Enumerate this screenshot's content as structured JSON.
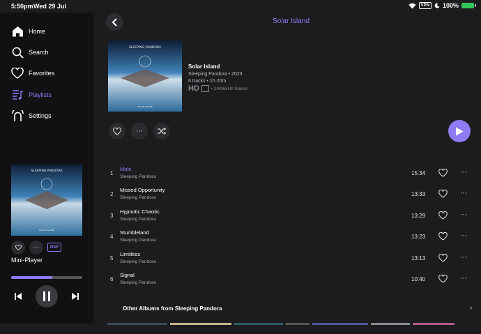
{
  "status": {
    "time": "5:50pm",
    "date": "Wed 29 Jul",
    "vpn": "VPN",
    "battery": "100%"
  },
  "sidebar": {
    "items": [
      {
        "label": "Home",
        "icon": "home-icon"
      },
      {
        "label": "Search",
        "icon": "search-icon"
      },
      {
        "label": "Favorites",
        "icon": "heart-icon"
      },
      {
        "label": "Playlists",
        "icon": "playlist-icon",
        "active": true
      },
      {
        "label": "Settings",
        "icon": "settings-icon"
      }
    ]
  },
  "mini_player": {
    "label": "Mini-Player",
    "dsp": "DSP",
    "progress": 0.58,
    "artist_on_art": "SLEEPING PANDORA",
    "title_on_art": "SOLAR ISLAND"
  },
  "header": {
    "title": "Solar Island"
  },
  "album": {
    "title": "Solar Island",
    "artist_year": "Sleeping Pandora • 2023",
    "meta": "6 tracks • 1h 20m",
    "hd": "HD",
    "quality": "• 24/96kHz Stereo",
    "art_artist": "SLEEPING PANDORA",
    "art_title": "SOLAR ISLAND"
  },
  "tracks": [
    {
      "num": "1",
      "title": "Mole",
      "artist": "Sleeping Pandora",
      "duration": "15:34",
      "current": true
    },
    {
      "num": "2",
      "title": "Missed Opportunity",
      "artist": "Sleeping Pandora",
      "duration": "13:33"
    },
    {
      "num": "3",
      "title": "Hypnotic Chaotic",
      "artist": "Sleeping Pandora",
      "duration": "13:29"
    },
    {
      "num": "4",
      "title": "Stumbleland",
      "artist": "Sleeping Pandora",
      "duration": "13:23"
    },
    {
      "num": "5",
      "title": "Limitless",
      "artist": "Sleeping Pandora",
      "duration": "13:13"
    },
    {
      "num": "6",
      "title": "Signal",
      "artist": "Sleeping Pandora",
      "duration": "10:40"
    }
  ],
  "other_albums": {
    "label": "Other Albums from Sleeping Pandora"
  },
  "colors": {
    "accent": "#8f7bf3",
    "background": "#1c1c1f",
    "sidebar": "#111113"
  }
}
